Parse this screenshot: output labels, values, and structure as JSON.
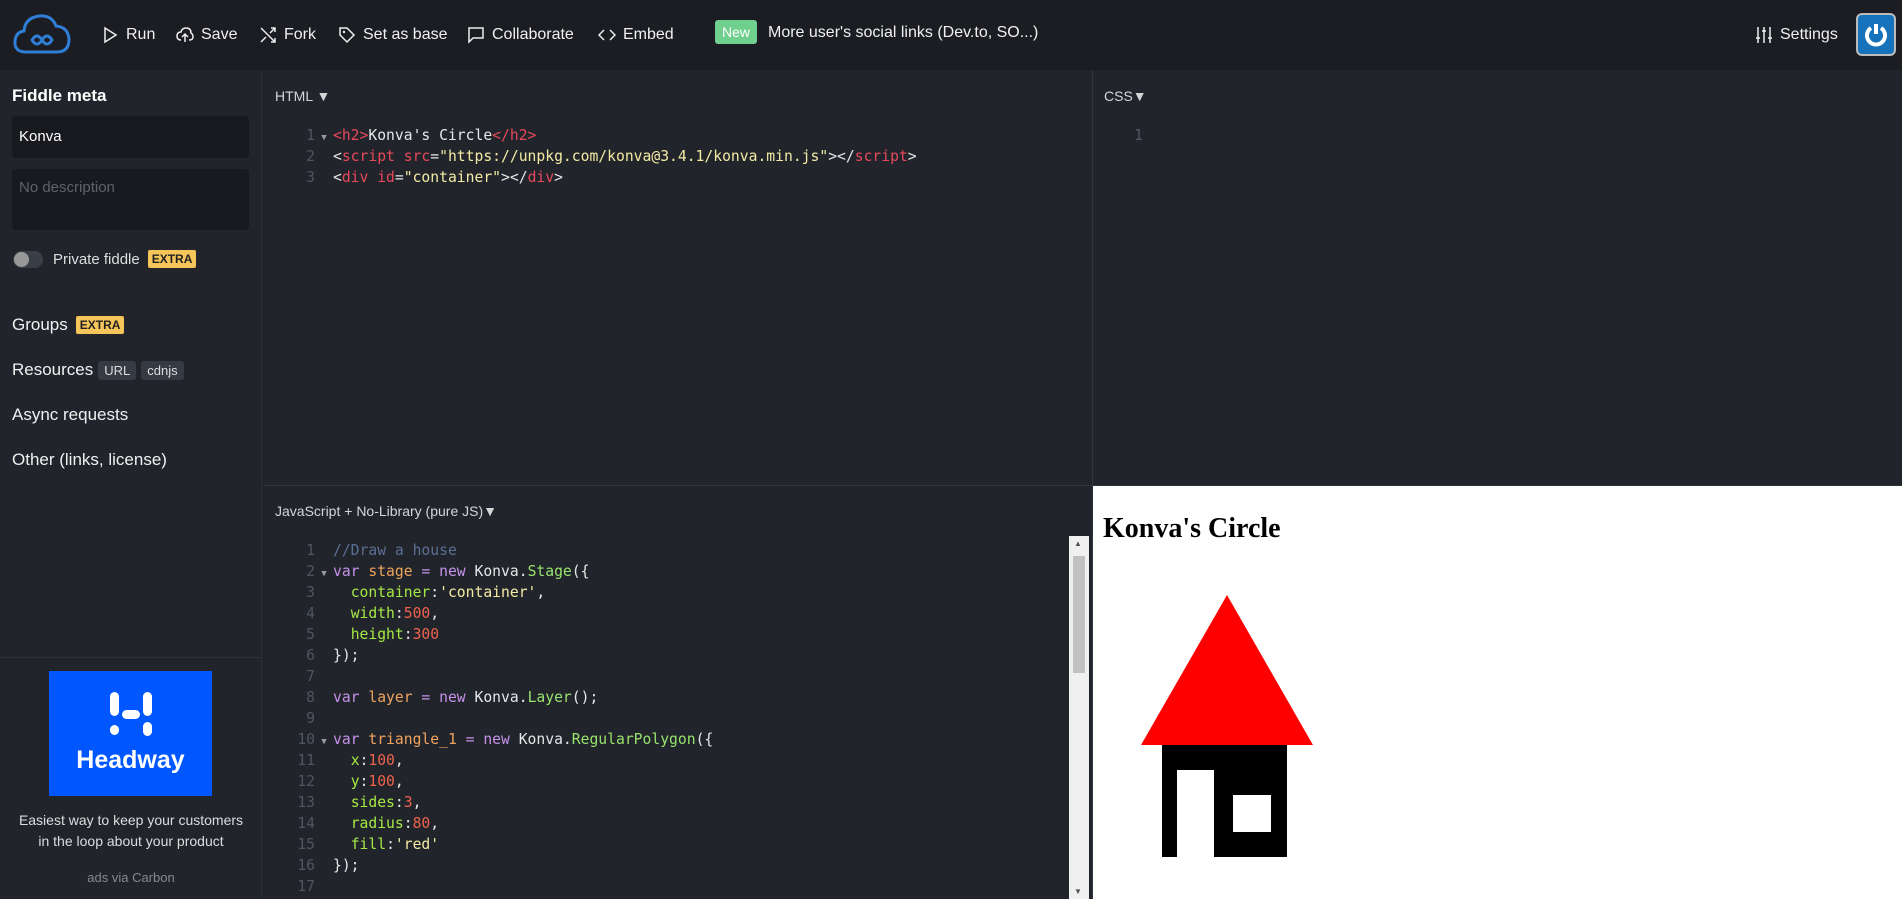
{
  "topbar": {
    "items": [
      {
        "label": "Run",
        "icon": "play-icon"
      },
      {
        "label": "Save",
        "icon": "cloud-upload-icon"
      },
      {
        "label": "Fork",
        "icon": "fork-icon"
      },
      {
        "label": "Set as base",
        "icon": "tag-icon"
      },
      {
        "label": "Collaborate",
        "icon": "chat-icon"
      },
      {
        "label": "Embed",
        "icon": "code-icon"
      }
    ],
    "new_badge": "New",
    "news": "More user's social links (Dev.to, SO...)",
    "settings": "Settings"
  },
  "sidebar": {
    "title": "Fiddle meta",
    "name_value": "Konva",
    "description_placeholder": "No description",
    "private_label": "Private fiddle",
    "extra": "EXTRA",
    "groups": "Groups",
    "resources": "Resources",
    "url_chip": "URL",
    "cdnjs_chip": "cdnjs",
    "async": "Async requests",
    "other": "Other (links, license)",
    "ad": {
      "brand": "Headway",
      "text1": "Easiest way to keep your customers",
      "text2": "in the loop about your product",
      "via": "ads via Carbon"
    }
  },
  "panels": {
    "html": "HTML",
    "css": "CSS",
    "js": "JavaScript + No-Library (pure JS)"
  },
  "html_code": [
    {
      "n": "1",
      "fold": true,
      "t": [
        [
          "tag",
          "<"
        ],
        [
          "tag",
          "h2"
        ],
        [
          "tag",
          ">"
        ],
        [
          "txt",
          "Konva's Circle"
        ],
        [
          "tag",
          "</"
        ],
        [
          "tag",
          "h2"
        ],
        [
          "tag",
          ">"
        ]
      ]
    },
    {
      "n": "2",
      "t": [
        [
          "txt",
          "<"
        ],
        [
          "tag",
          "script"
        ],
        [
          "txt",
          " "
        ],
        [
          "attr",
          "src"
        ],
        [
          "txt",
          "="
        ],
        [
          "str",
          "\"https://unpkg.com/konva@3.4.1/konva.min.js\""
        ],
        [
          "txt",
          "></"
        ],
        [
          "tag",
          "script"
        ],
        [
          "txt",
          ">"
        ]
      ]
    },
    {
      "n": "3",
      "t": [
        [
          "txt",
          "<"
        ],
        [
          "tag",
          "div"
        ],
        [
          "txt",
          " "
        ],
        [
          "attr",
          "id"
        ],
        [
          "txt",
          "="
        ],
        [
          "str",
          "\"container\""
        ],
        [
          "txt",
          "></"
        ],
        [
          "tag",
          "div"
        ],
        [
          "txt",
          ">"
        ]
      ]
    }
  ],
  "css_code": [
    {
      "n": "1",
      "t": []
    }
  ],
  "js_code": [
    {
      "n": "1",
      "t": [
        [
          "cm",
          "//Draw a house"
        ]
      ]
    },
    {
      "n": "2",
      "fold": true,
      "t": [
        [
          "kw",
          "var "
        ],
        [
          "var",
          "stage"
        ],
        [
          "kw",
          " = new "
        ],
        [
          "cls",
          "Konva."
        ],
        [
          "fn",
          "Stage"
        ],
        [
          "p",
          "({"
        ]
      ]
    },
    {
      "n": "3",
      "t": [
        [
          "p",
          "  "
        ],
        [
          "prop",
          "container"
        ],
        [
          "p",
          ":"
        ],
        [
          "str",
          "'container'"
        ],
        [
          "p",
          ","
        ]
      ]
    },
    {
      "n": "4",
      "t": [
        [
          "p",
          "  "
        ],
        [
          "prop",
          "width"
        ],
        [
          "p",
          ":"
        ],
        [
          "n",
          "500"
        ],
        [
          "p",
          ","
        ]
      ]
    },
    {
      "n": "5",
      "t": [
        [
          "p",
          "  "
        ],
        [
          "prop",
          "height"
        ],
        [
          "p",
          ":"
        ],
        [
          "n",
          "300"
        ]
      ]
    },
    {
      "n": "6",
      "t": [
        [
          "p",
          "});"
        ]
      ]
    },
    {
      "n": "7",
      "t": []
    },
    {
      "n": "8",
      "t": [
        [
          "kw",
          "var "
        ],
        [
          "var",
          "layer"
        ],
        [
          "kw",
          " = new "
        ],
        [
          "cls",
          "Konva."
        ],
        [
          "fn",
          "Layer"
        ],
        [
          "p",
          "();"
        ]
      ]
    },
    {
      "n": "9",
      "t": []
    },
    {
      "n": "10",
      "fold": true,
      "t": [
        [
          "kw",
          "var "
        ],
        [
          "var",
          "triangle_1"
        ],
        [
          "kw",
          " = new "
        ],
        [
          "cls",
          "Konva."
        ],
        [
          "fn",
          "RegularPolygon"
        ],
        [
          "p",
          "({"
        ]
      ]
    },
    {
      "n": "11",
      "t": [
        [
          "p",
          "  "
        ],
        [
          "prop",
          "x"
        ],
        [
          "p",
          ":"
        ],
        [
          "n",
          "100"
        ],
        [
          "p",
          ","
        ]
      ]
    },
    {
      "n": "12",
      "t": [
        [
          "p",
          "  "
        ],
        [
          "prop",
          "y"
        ],
        [
          "p",
          ":"
        ],
        [
          "n",
          "100"
        ],
        [
          "p",
          ","
        ]
      ]
    },
    {
      "n": "13",
      "t": [
        [
          "p",
          "  "
        ],
        [
          "prop",
          "sides"
        ],
        [
          "p",
          ":"
        ],
        [
          "n",
          "3"
        ],
        [
          "p",
          ","
        ]
      ]
    },
    {
      "n": "14",
      "t": [
        [
          "p",
          "  "
        ],
        [
          "prop",
          "radius"
        ],
        [
          "p",
          ":"
        ],
        [
          "n",
          "80"
        ],
        [
          "p",
          ","
        ]
      ]
    },
    {
      "n": "15",
      "t": [
        [
          "p",
          "  "
        ],
        [
          "prop",
          "fill"
        ],
        [
          "p",
          ":"
        ],
        [
          "str",
          "'red'"
        ]
      ]
    },
    {
      "n": "16",
      "t": [
        [
          "p",
          "});"
        ]
      ]
    },
    {
      "n": "17",
      "t": []
    }
  ],
  "preview": {
    "heading": "Konva's Circle",
    "roof_color": "#ff0000",
    "body_color": "#000000"
  },
  "colors": {
    "accent": "#1672bb",
    "new_badge": "#6fcf8c",
    "extra": "#f5c55a",
    "ad_bg": "#0057ff"
  }
}
